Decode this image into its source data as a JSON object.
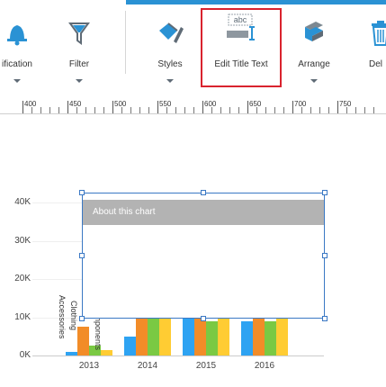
{
  "ribbon": {
    "accent_color": "#2a92d4",
    "buttons": [
      {
        "label": "ification",
        "icon": "bell-icon",
        "has_caret": true
      },
      {
        "label": "Filter",
        "icon": "funnel-icon",
        "has_caret": true
      },
      {
        "label": "Styles",
        "icon": "paint-bucket-icon",
        "has_caret": true
      },
      {
        "label": "Edit Title Text",
        "icon": "edit-title-text-icon",
        "icon_text": "abc",
        "has_caret": false,
        "highlighted": true
      },
      {
        "label": "Arrange",
        "icon": "arrange-layers-icon",
        "has_caret": true
      },
      {
        "label": "Del",
        "icon": "trash-icon",
        "has_caret": false
      }
    ]
  },
  "ruler": {
    "labels": [
      "400",
      "450",
      "500",
      "550",
      "600",
      "650",
      "700",
      "750"
    ]
  },
  "overlay": {
    "title": "About this chart"
  },
  "chart_data": {
    "type": "bar",
    "categories": [
      "2013",
      "2014",
      "2015",
      "2016"
    ],
    "ylim": [
      0,
      40000
    ],
    "y_ticks": [
      "0K",
      "10K",
      "20K",
      "30K",
      "40K"
    ],
    "category_labels_2013": [
      "Accessories",
      "Clothing",
      "Components"
    ],
    "colors": [
      "#2ea3f2",
      "#f28c28",
      "#7ac943",
      "#ffcc33"
    ],
    "series": [
      {
        "values": [
          1000,
          5000,
          11000,
          9000
        ]
      },
      {
        "values": [
          7500,
          11000,
          11000,
          11000
        ]
      },
      {
        "values": [
          2500,
          11000,
          9000,
          9000
        ]
      },
      {
        "values": [
          1500,
          10000,
          10000,
          10000
        ]
      }
    ]
  }
}
